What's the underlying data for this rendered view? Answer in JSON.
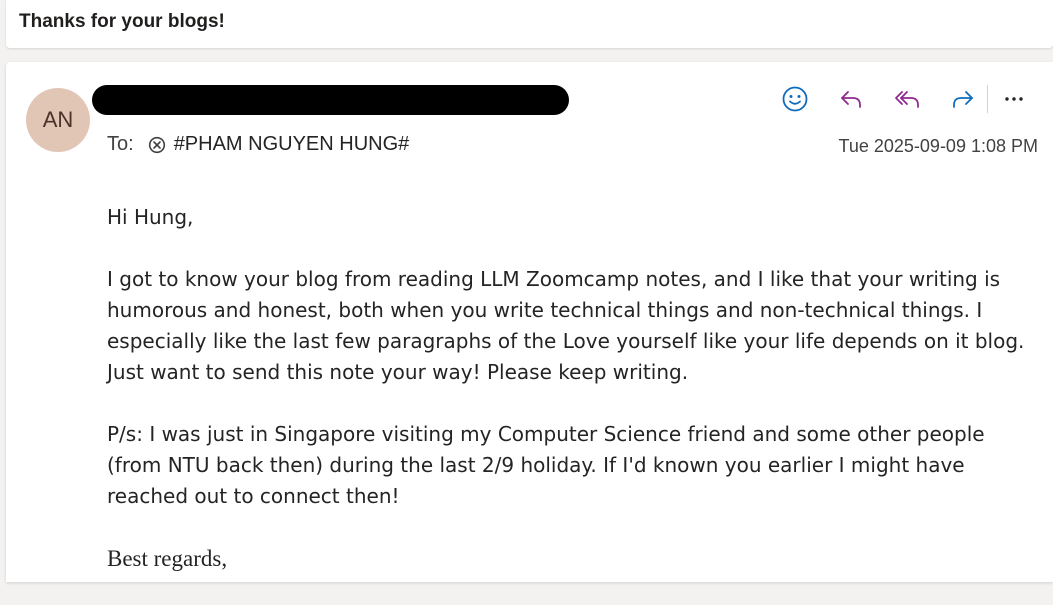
{
  "subject": "Thanks for your blogs!",
  "message": {
    "avatar_initials": "AN",
    "to_label": "To:",
    "recipient": "#PHAM NGUYEN HUNG#",
    "date": "Tue 2025-09-09 1:08 PM",
    "toolbar": {
      "icons": [
        "emoji-icon",
        "reply-icon",
        "reply-all-icon",
        "forward-icon",
        "more-icon"
      ],
      "more_label": "···"
    },
    "body": {
      "greeting": "Hi Hung,",
      "paragraph1": "I got to know your blog from reading LLM Zoomcamp notes, and I like that your writing is humorous and honest, both when you write technical things and non-technical things. I especially like the last few paragraphs of the Love yourself like your life depends on it blog. Just want to send this note your way! Please keep writing.",
      "paragraph2": "P/s: I was just in Singapore visiting my Computer Science friend and some other people (from NTU back then) during the last 2/9 holiday. If I'd known you earlier I might have reached out to connect then!",
      "signoff": "Best regards,"
    }
  },
  "colors": {
    "accent_blue": "#0f6cbd",
    "reply_purple": "#8f2a8f",
    "avatar_bg": "#e1c6b6"
  }
}
